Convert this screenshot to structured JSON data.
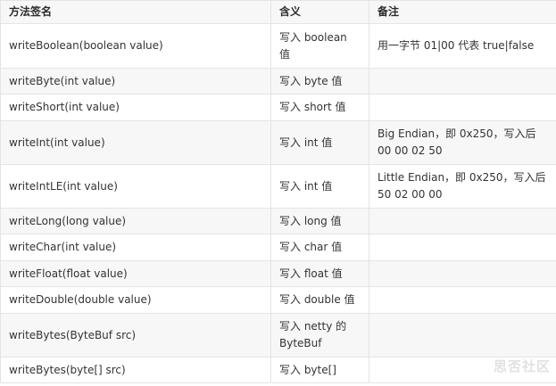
{
  "table": {
    "headers": [
      "方法签名",
      "含义",
      "备注"
    ],
    "rows": [
      {
        "method": "writeBoolean(boolean value)",
        "meaning": "写入 boolean 值",
        "note": "用一字节 01|00 代表 true|false"
      },
      {
        "method": "writeByte(int value)",
        "meaning": "写入 byte 值",
        "note": ""
      },
      {
        "method": "writeShort(int value)",
        "meaning": "写入 short 值",
        "note": ""
      },
      {
        "method": "writeInt(int value)",
        "meaning": "写入 int 值",
        "note": "Big Endian，即 0x250，写入后 00 00 02 50"
      },
      {
        "method": "writeIntLE(int value)",
        "meaning": "写入 int 值",
        "note": "Little Endian，即 0x250，写入后 50 02 00 00"
      },
      {
        "method": "writeLong(long value)",
        "meaning": "写入 long 值",
        "note": ""
      },
      {
        "method": "writeChar(int value)",
        "meaning": "写入 char 值",
        "note": ""
      },
      {
        "method": "writeFloat(float value)",
        "meaning": "写入 float 值",
        "note": ""
      },
      {
        "method": "writeDouble(double value)",
        "meaning": "写入 double 值",
        "note": ""
      },
      {
        "method": "writeBytes(ByteBuf src)",
        "meaning": "写入 netty 的 ByteBuf",
        "note": ""
      },
      {
        "method": "writeBytes(byte[] src)",
        "meaning": "写入 byte[]",
        "note": ""
      }
    ]
  },
  "watermark": "思否社区"
}
